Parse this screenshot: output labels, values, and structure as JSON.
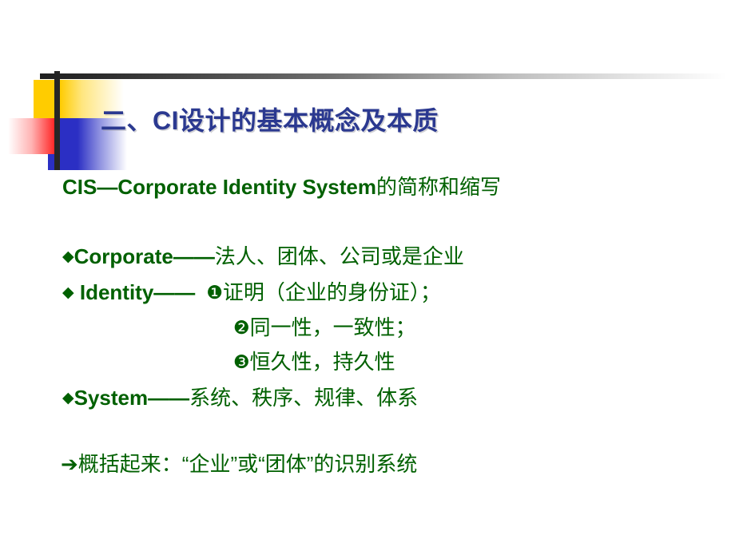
{
  "slide": {
    "title": "二、CI设计的基本概念及本质",
    "title_color": "#2B3990",
    "body_color": "#006000",
    "accent_colors": {
      "yellow": "#FFCC00",
      "red": "#FF0000",
      "blue": "#2B2FC4",
      "bar": "#262626"
    }
  },
  "body": {
    "lead": {
      "english": "CIS—Corporate Identity System",
      "chinese": "的简称和缩写"
    },
    "bullets": [
      {
        "glyph": "◆",
        "term": "Corporate",
        "dash": "——",
        "text": "法人、团体、公司或是企业"
      },
      {
        "glyph": "◆",
        "term": " Identity",
        "dash": "——",
        "marker": "❶",
        "text": "证明（企业的身份证）；"
      },
      {
        "glyph": "◆",
        "term": "System",
        "dash": "——",
        "text": "系统、秩序、规律、体系"
      }
    ],
    "sub_items": [
      {
        "marker": "❷",
        "text": "同一性，一致性；"
      },
      {
        "marker": "❸",
        "text": "恒久性，持久性"
      }
    ],
    "conclusion": {
      "arrow": "➔",
      "text": "概括起来：“企业”或“团体”的识别系统"
    }
  }
}
